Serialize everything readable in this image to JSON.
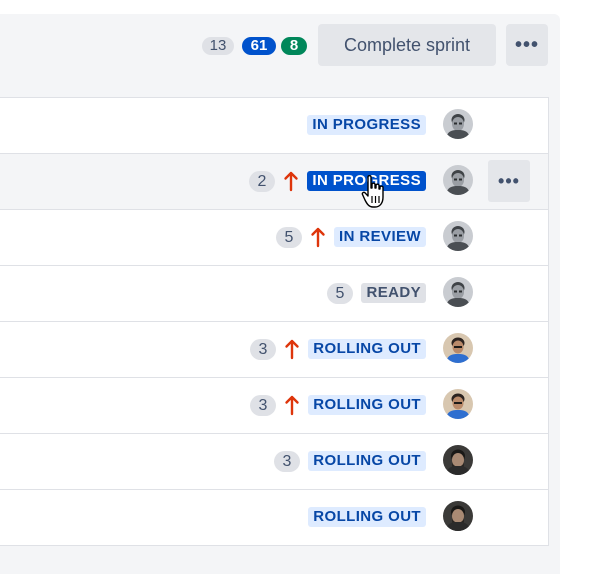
{
  "header": {
    "issue_counts": {
      "todo": "13",
      "in_progress": "61",
      "done": "8"
    },
    "complete_sprint_label": "Complete sprint",
    "more_label": "•••"
  },
  "rows": [
    {
      "status": "IN PROGRESS",
      "status_key": "inprogress",
      "points": "",
      "priority": "",
      "avatar": "avatar-gray",
      "selected": false,
      "hover": false
    },
    {
      "status": "IN PROGRESS",
      "status_key": "inprogress",
      "points": "2",
      "priority": "high",
      "avatar": "avatar-gray",
      "selected": true,
      "hover": true,
      "row_more_label": "•••"
    },
    {
      "status": "IN REVIEW",
      "status_key": "inreview",
      "points": "5",
      "priority": "high",
      "avatar": "avatar-gray",
      "selected": false,
      "hover": false
    },
    {
      "status": "READY",
      "status_key": "ready",
      "points": "5",
      "priority": "",
      "avatar": "avatar-gray",
      "selected": false,
      "hover": false
    },
    {
      "status": "ROLLING OUT",
      "status_key": "rollingout",
      "points": "3",
      "priority": "high",
      "avatar": "avatar-color",
      "selected": false,
      "hover": false
    },
    {
      "status": "ROLLING OUT",
      "status_key": "rollingout",
      "points": "3",
      "priority": "high",
      "avatar": "avatar-color",
      "selected": false,
      "hover": false
    },
    {
      "status": "ROLLING OUT",
      "status_key": "rollingout",
      "points": "3",
      "priority": "",
      "avatar": "avatar-dark",
      "selected": false,
      "hover": false
    },
    {
      "status": "ROLLING OUT",
      "status_key": "rollingout",
      "points": "",
      "priority": "",
      "avatar": "avatar-dark",
      "selected": false,
      "hover": false
    }
  ],
  "colors": {
    "priority_high": "#de350b",
    "selected_status_bg": "#0052cc"
  }
}
